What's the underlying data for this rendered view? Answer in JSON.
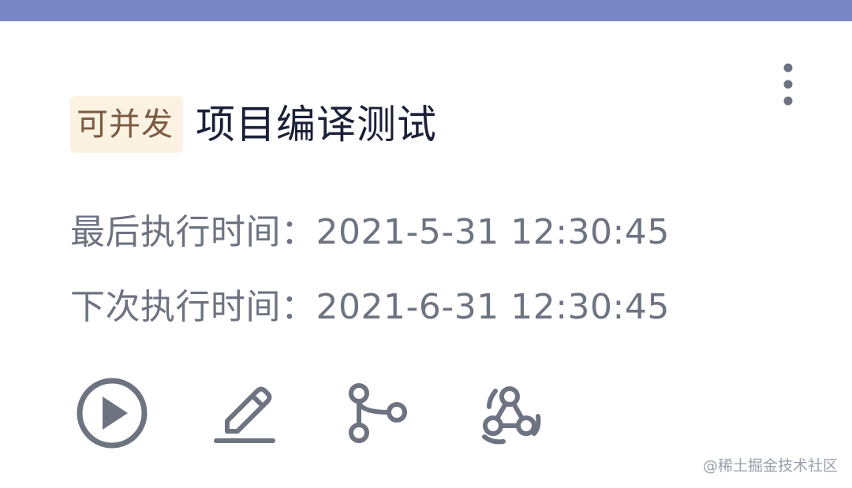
{
  "header": {
    "accent_color": "#7b86c6"
  },
  "card": {
    "badge": "可并发",
    "title": "项目编译测试",
    "more_icon": "more-vertical-icon",
    "last_run": {
      "label": "最后执行时间：",
      "value": "2021-5-31 12:30:45"
    },
    "next_run": {
      "label": "下次执行时间：",
      "value": "2021-6-31 12:30:45"
    },
    "actions": [
      {
        "icon": "play-icon"
      },
      {
        "icon": "edit-icon"
      },
      {
        "icon": "branch-icon"
      },
      {
        "icon": "webhook-icon"
      }
    ]
  },
  "watermark": "@稀土掘金技术社区",
  "colors": {
    "icon": "#6e7381",
    "title": "#1a2038",
    "badge_bg": "#fbf2e2",
    "badge_text": "#7b5a40"
  }
}
